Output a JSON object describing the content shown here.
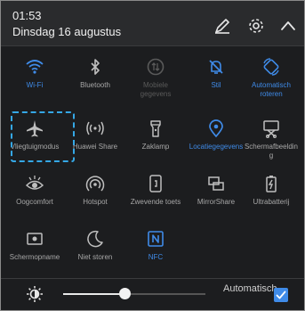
{
  "header": {
    "time": "01:53",
    "date": "Dinsdag 16 augustus",
    "edit_icon": "pencil-icon",
    "settings_icon": "gear-icon",
    "collapse_icon": "chevron-up-icon"
  },
  "colors": {
    "active": "#3f8be8",
    "inactive": "#a8a8a8",
    "disabled": "#5a5a5a",
    "highlight_border": "#35a8e6",
    "background": "#1c1d1f"
  },
  "tiles": [
    {
      "label": "Wi-Fi",
      "icon": "wifi-icon",
      "state": "on"
    },
    {
      "label": "Bluetooth",
      "icon": "bluetooth-icon",
      "state": "off"
    },
    {
      "label": "Mobiele gegevens",
      "icon": "mobile-data-icon",
      "state": "disabled"
    },
    {
      "label": "Stil",
      "icon": "mute-icon",
      "state": "on"
    },
    {
      "label": "Automatisch roteren",
      "icon": "auto-rotate-icon",
      "state": "on"
    },
    {
      "label": "Vliegtuigmodus",
      "icon": "airplane-icon",
      "state": "off"
    },
    {
      "label": "Huawei Share",
      "icon": "huawei-share-icon",
      "state": "off"
    },
    {
      "label": "Zaklamp",
      "icon": "flashlight-icon",
      "state": "off"
    },
    {
      "label": "Locatiegegevens",
      "icon": "location-icon",
      "state": "on"
    },
    {
      "label": "Schermafbeelding",
      "icon": "screenshot-icon",
      "state": "off"
    },
    {
      "label": "Oogcomfort",
      "icon": "eye-icon",
      "state": "off"
    },
    {
      "label": "Hotspot",
      "icon": "hotspot-icon",
      "state": "off"
    },
    {
      "label": "Zwevende toets",
      "icon": "floating-button-icon",
      "state": "off"
    },
    {
      "label": "MirrorShare",
      "icon": "mirrorshare-icon",
      "state": "off"
    },
    {
      "label": "Ultrabatterij",
      "icon": "battery-icon",
      "state": "off"
    },
    {
      "label": "Schermopname",
      "icon": "screen-record-icon",
      "state": "off"
    },
    {
      "label": "Niet storen",
      "icon": "moon-icon",
      "state": "off"
    },
    {
      "label": "NFC",
      "icon": "nfc-icon",
      "state": "on"
    }
  ],
  "brightness": {
    "icon": "brightness-icon",
    "level": 0.43,
    "auto_label": "Automatisch",
    "auto_checked": true
  }
}
